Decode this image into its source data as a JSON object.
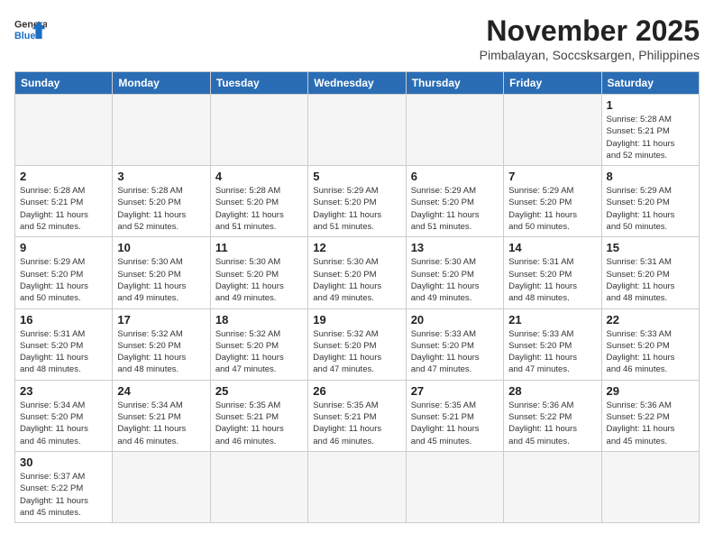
{
  "header": {
    "logo_text_general": "General",
    "logo_text_blue": "Blue",
    "title": "November 2025",
    "subtitle": "Pimbalayan, Soccsksargen, Philippines"
  },
  "weekdays": [
    "Sunday",
    "Monday",
    "Tuesday",
    "Wednesday",
    "Thursday",
    "Friday",
    "Saturday"
  ],
  "weeks": [
    [
      {
        "day": "",
        "info": ""
      },
      {
        "day": "",
        "info": ""
      },
      {
        "day": "",
        "info": ""
      },
      {
        "day": "",
        "info": ""
      },
      {
        "day": "",
        "info": ""
      },
      {
        "day": "",
        "info": ""
      },
      {
        "day": "1",
        "info": "Sunrise: 5:28 AM\nSunset: 5:21 PM\nDaylight: 11 hours\nand 52 minutes."
      }
    ],
    [
      {
        "day": "2",
        "info": "Sunrise: 5:28 AM\nSunset: 5:21 PM\nDaylight: 11 hours\nand 52 minutes."
      },
      {
        "day": "3",
        "info": "Sunrise: 5:28 AM\nSunset: 5:20 PM\nDaylight: 11 hours\nand 52 minutes."
      },
      {
        "day": "4",
        "info": "Sunrise: 5:28 AM\nSunset: 5:20 PM\nDaylight: 11 hours\nand 51 minutes."
      },
      {
        "day": "5",
        "info": "Sunrise: 5:29 AM\nSunset: 5:20 PM\nDaylight: 11 hours\nand 51 minutes."
      },
      {
        "day": "6",
        "info": "Sunrise: 5:29 AM\nSunset: 5:20 PM\nDaylight: 11 hours\nand 51 minutes."
      },
      {
        "day": "7",
        "info": "Sunrise: 5:29 AM\nSunset: 5:20 PM\nDaylight: 11 hours\nand 50 minutes."
      },
      {
        "day": "8",
        "info": "Sunrise: 5:29 AM\nSunset: 5:20 PM\nDaylight: 11 hours\nand 50 minutes."
      }
    ],
    [
      {
        "day": "9",
        "info": "Sunrise: 5:29 AM\nSunset: 5:20 PM\nDaylight: 11 hours\nand 50 minutes."
      },
      {
        "day": "10",
        "info": "Sunrise: 5:30 AM\nSunset: 5:20 PM\nDaylight: 11 hours\nand 49 minutes."
      },
      {
        "day": "11",
        "info": "Sunrise: 5:30 AM\nSunset: 5:20 PM\nDaylight: 11 hours\nand 49 minutes."
      },
      {
        "day": "12",
        "info": "Sunrise: 5:30 AM\nSunset: 5:20 PM\nDaylight: 11 hours\nand 49 minutes."
      },
      {
        "day": "13",
        "info": "Sunrise: 5:30 AM\nSunset: 5:20 PM\nDaylight: 11 hours\nand 49 minutes."
      },
      {
        "day": "14",
        "info": "Sunrise: 5:31 AM\nSunset: 5:20 PM\nDaylight: 11 hours\nand 48 minutes."
      },
      {
        "day": "15",
        "info": "Sunrise: 5:31 AM\nSunset: 5:20 PM\nDaylight: 11 hours\nand 48 minutes."
      }
    ],
    [
      {
        "day": "16",
        "info": "Sunrise: 5:31 AM\nSunset: 5:20 PM\nDaylight: 11 hours\nand 48 minutes."
      },
      {
        "day": "17",
        "info": "Sunrise: 5:32 AM\nSunset: 5:20 PM\nDaylight: 11 hours\nand 48 minutes."
      },
      {
        "day": "18",
        "info": "Sunrise: 5:32 AM\nSunset: 5:20 PM\nDaylight: 11 hours\nand 47 minutes."
      },
      {
        "day": "19",
        "info": "Sunrise: 5:32 AM\nSunset: 5:20 PM\nDaylight: 11 hours\nand 47 minutes."
      },
      {
        "day": "20",
        "info": "Sunrise: 5:33 AM\nSunset: 5:20 PM\nDaylight: 11 hours\nand 47 minutes."
      },
      {
        "day": "21",
        "info": "Sunrise: 5:33 AM\nSunset: 5:20 PM\nDaylight: 11 hours\nand 47 minutes."
      },
      {
        "day": "22",
        "info": "Sunrise: 5:33 AM\nSunset: 5:20 PM\nDaylight: 11 hours\nand 46 minutes."
      }
    ],
    [
      {
        "day": "23",
        "info": "Sunrise: 5:34 AM\nSunset: 5:20 PM\nDaylight: 11 hours\nand 46 minutes."
      },
      {
        "day": "24",
        "info": "Sunrise: 5:34 AM\nSunset: 5:21 PM\nDaylight: 11 hours\nand 46 minutes."
      },
      {
        "day": "25",
        "info": "Sunrise: 5:35 AM\nSunset: 5:21 PM\nDaylight: 11 hours\nand 46 minutes."
      },
      {
        "day": "26",
        "info": "Sunrise: 5:35 AM\nSunset: 5:21 PM\nDaylight: 11 hours\nand 46 minutes."
      },
      {
        "day": "27",
        "info": "Sunrise: 5:35 AM\nSunset: 5:21 PM\nDaylight: 11 hours\nand 45 minutes."
      },
      {
        "day": "28",
        "info": "Sunrise: 5:36 AM\nSunset: 5:22 PM\nDaylight: 11 hours\nand 45 minutes."
      },
      {
        "day": "29",
        "info": "Sunrise: 5:36 AM\nSunset: 5:22 PM\nDaylight: 11 hours\nand 45 minutes."
      }
    ],
    [
      {
        "day": "30",
        "info": "Sunrise: 5:37 AM\nSunset: 5:22 PM\nDaylight: 11 hours\nand 45 minutes."
      },
      {
        "day": "",
        "info": ""
      },
      {
        "day": "",
        "info": ""
      },
      {
        "day": "",
        "info": ""
      },
      {
        "day": "",
        "info": ""
      },
      {
        "day": "",
        "info": ""
      },
      {
        "day": "",
        "info": ""
      }
    ]
  ]
}
